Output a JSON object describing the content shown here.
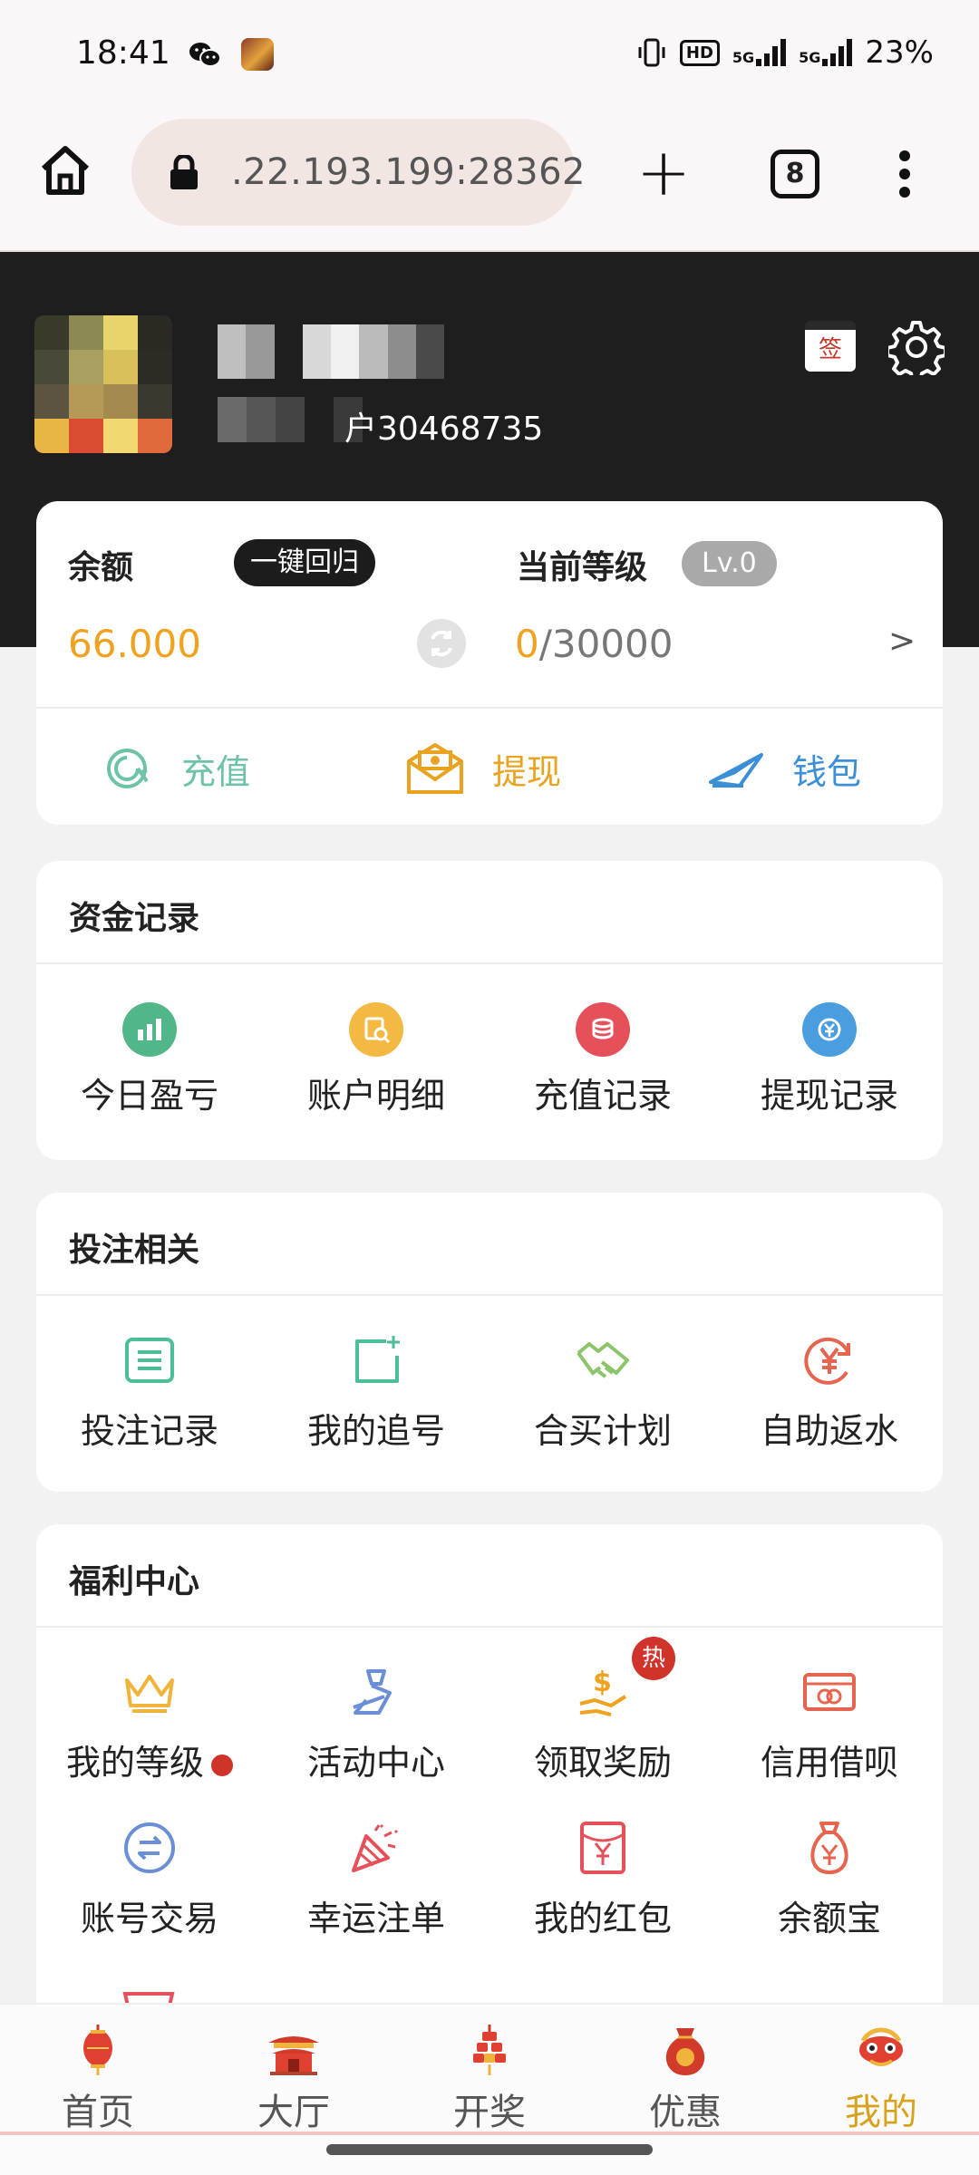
{
  "status_bar": {
    "time": "18:41",
    "battery": "23%",
    "net1": "5G",
    "net2": "5G",
    "hd": "HD",
    "icons": [
      "wechat-icon",
      "game-avatar-icon",
      "vibrate-icon",
      "signal-icon",
      "signal-icon"
    ]
  },
  "browser": {
    "url": ".22.193.199:28362",
    "tab_count": "8",
    "plus": "+"
  },
  "profile": {
    "user_id_label": "户30468735",
    "sign_label": "签"
  },
  "balance": {
    "balance_label": "余额",
    "recall_button": "一键回归",
    "balance_value": "66.000",
    "level_label": "当前等级",
    "level_badge": "Lv.0",
    "level_progress_current": "0",
    "level_progress_total": "/30000",
    "chevron": ">",
    "actions": [
      {
        "label": "充值",
        "color": "#6cc3a6",
        "icon": "recharge-icon"
      },
      {
        "label": "提现",
        "color": "#eaa31f",
        "icon": "withdraw-icon"
      },
      {
        "label": "钱包",
        "color": "#3b8fd6",
        "icon": "wallet-icon"
      }
    ]
  },
  "funds": {
    "title": "资金记录",
    "items": [
      {
        "label": "今日盈亏",
        "icon": "chart-icon",
        "color": "#52b788"
      },
      {
        "label": "账户明细",
        "icon": "detail-icon",
        "color": "#f4b942"
      },
      {
        "label": "充值记录",
        "icon": "coins-icon",
        "color": "#e5505a"
      },
      {
        "label": "提现记录",
        "icon": "yuan-exchange-icon",
        "color": "#4a9ee0"
      }
    ]
  },
  "betting": {
    "title": "投注相关",
    "items": [
      {
        "label": "投注记录",
        "icon": "list-icon",
        "color": "#4dbf96"
      },
      {
        "label": "我的追号",
        "icon": "add-square-icon",
        "color": "#4dbf96"
      },
      {
        "label": "合买计划",
        "icon": "handshake-icon",
        "color": "#8cc46a"
      },
      {
        "label": "自助返水",
        "icon": "yuan-cycle-icon",
        "color": "#e5654f"
      }
    ]
  },
  "welfare": {
    "title": "福利中心",
    "row1": [
      {
        "label": "我的等级",
        "icon": "crown-icon",
        "color": "#f0b43c"
      },
      {
        "label": "活动中心",
        "icon": "activity-icon",
        "color": "#6b8fd6"
      },
      {
        "label": "领取奖励",
        "icon": "reward-icon",
        "color": "#f0a21e",
        "badge": "热"
      },
      {
        "label": "信用借呗",
        "icon": "card-icon",
        "color": "#e5654f"
      }
    ],
    "row2": [
      {
        "label": "账号交易",
        "icon": "exchange-icon",
        "color": "#6b8fd6"
      },
      {
        "label": "幸运注单",
        "icon": "confetti-icon",
        "color": "#e5505a"
      },
      {
        "label": "我的红包",
        "icon": "red-envelope-icon",
        "color": "#e5505a"
      },
      {
        "label": "余额宝",
        "icon": "money-bag-icon",
        "color": "#e5654f"
      }
    ]
  },
  "nav": {
    "items": [
      {
        "label": "首页",
        "icon": "lantern-icon"
      },
      {
        "label": "大厅",
        "icon": "temple-icon"
      },
      {
        "label": "开奖",
        "icon": "firecracker-icon"
      },
      {
        "label": "优惠",
        "icon": "lucky-bag-icon"
      },
      {
        "label": "我的",
        "icon": "lion-dance-icon"
      }
    ],
    "active_color": "#d8a21e"
  }
}
